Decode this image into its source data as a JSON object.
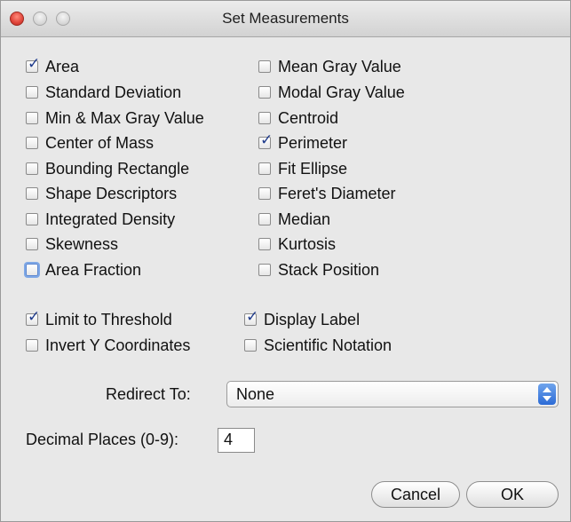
{
  "window": {
    "title": "Set Measurements"
  },
  "measurements": {
    "left": [
      {
        "label": "Area",
        "checked": true
      },
      {
        "label": "Standard Deviation",
        "checked": false
      },
      {
        "label": "Min & Max Gray Value",
        "checked": false
      },
      {
        "label": "Center of Mass",
        "checked": false
      },
      {
        "label": "Bounding Rectangle",
        "checked": false
      },
      {
        "label": "Shape Descriptors",
        "checked": false
      },
      {
        "label": "Integrated Density",
        "checked": false
      },
      {
        "label": "Skewness",
        "checked": false
      },
      {
        "label": "Area Fraction",
        "checked": false,
        "focused": true
      }
    ],
    "right": [
      {
        "label": "Mean Gray Value",
        "checked": false
      },
      {
        "label": "Modal Gray Value",
        "checked": false
      },
      {
        "label": "Centroid",
        "checked": false
      },
      {
        "label": "Perimeter",
        "checked": true
      },
      {
        "label": "Fit Ellipse",
        "checked": false
      },
      {
        "label": "Feret's Diameter",
        "checked": false
      },
      {
        "label": "Median",
        "checked": false
      },
      {
        "label": "Kurtosis",
        "checked": false
      },
      {
        "label": "Stack Position",
        "checked": false
      }
    ]
  },
  "options": {
    "limit_to_threshold": {
      "label": "Limit to Threshold",
      "checked": true
    },
    "display_label": {
      "label": "Display Label",
      "checked": true
    },
    "invert_y": {
      "label": "Invert Y Coordinates",
      "checked": false
    },
    "scientific_notation": {
      "label": "Scientific Notation",
      "checked": false
    }
  },
  "redirect": {
    "label": "Redirect To:",
    "value": "None"
  },
  "decimal": {
    "label": "Decimal Places (0-9):",
    "value": "4"
  },
  "buttons": {
    "cancel": "Cancel",
    "ok": "OK"
  },
  "colors": {
    "checkmark": "#1f3b8c",
    "focus_ring": "#7fa8e6",
    "stepper": "#2c6bd6"
  }
}
